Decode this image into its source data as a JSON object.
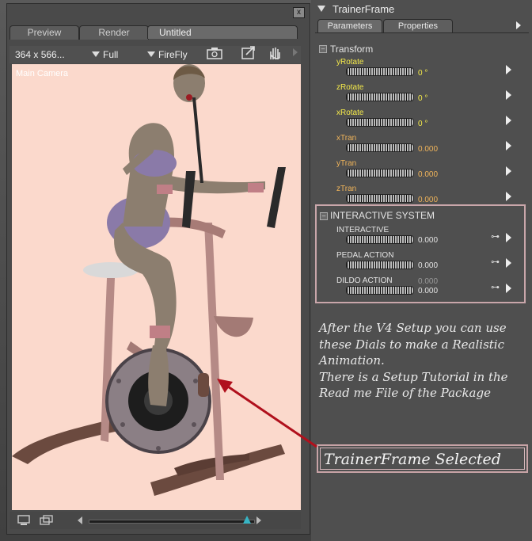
{
  "left_panel": {
    "close_label": "x",
    "tabs": [
      {
        "label": "Preview"
      },
      {
        "label": "Render"
      },
      {
        "label": "Untitled"
      }
    ],
    "toolbar": {
      "resolution": "364 x 566...",
      "quality": "Full",
      "renderer": "FireFly"
    },
    "viewport": {
      "camera_label": "Main Camera"
    }
  },
  "right_panel": {
    "title": "TrainerFrame",
    "tabs": [
      {
        "label": "Parameters"
      },
      {
        "label": "Properties"
      }
    ],
    "transform_group": {
      "label": "Transform",
      "params": [
        {
          "label": "yRotate",
          "value": "0 °"
        },
        {
          "label": "zRotate",
          "value": "0 °"
        },
        {
          "label": "xRotate",
          "value": "0 °"
        },
        {
          "label": "xTran",
          "value": "0.000"
        },
        {
          "label": "yTran",
          "value": "0.000"
        },
        {
          "label": "zTran",
          "value": "0.000"
        }
      ]
    },
    "interactive_group": {
      "label": "INTERACTIVE SYSTEM",
      "params": [
        {
          "label": "INTERACTIVE",
          "value": "0.000"
        },
        {
          "label": "PEDAL ACTION",
          "value": "0.000"
        },
        {
          "label": "DILDO ACTION",
          "value": "0.000",
          "value2": "0.000"
        }
      ]
    },
    "note": {
      "lines": [
        "After the V4 Setup you can use",
        "these Dials to make a Realistic",
        "Animation.",
        "There is a Setup Tutorial in the",
        "Read me File of the Package"
      ]
    },
    "selected_label": "TrainerFrame Selected"
  },
  "colors": {
    "viewport_bg": "#fbd9cc",
    "annotation_border": "#c9a6aa",
    "arrow": "#b0101c"
  }
}
